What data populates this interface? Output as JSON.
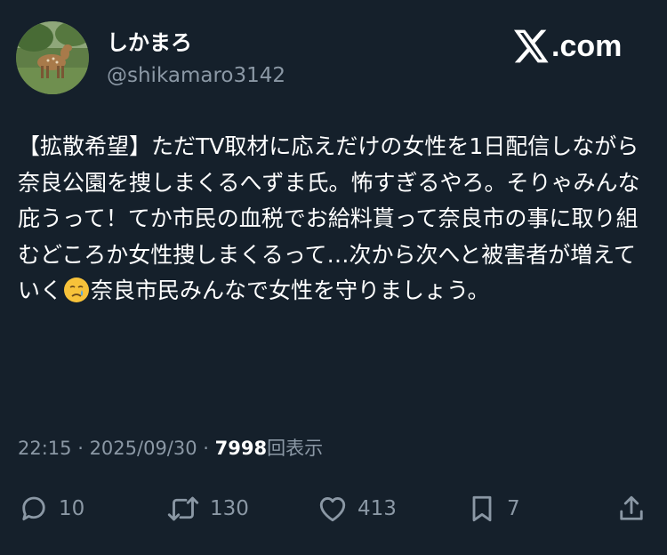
{
  "author": {
    "display_name": "しかまろ",
    "handle": "@shikamaro3142",
    "avatar_icon": "deer-photo-avatar"
  },
  "brand": {
    "icon": "x-logo-icon",
    "text": ".com"
  },
  "tweet": {
    "text_before_emoji": "【拡散希望】ただTV取材に応えだけの女性を1日配信しながら奈良公園を捜しまくるへずま氏。怖すぎるやろ。そりゃみんな庇うって！てか市民の血税でお給料貰って奈良市の事に取り組むどころか女性捜しまくるって…次から次へと被害者が増えていく",
    "emoji": "crying-face-emoji",
    "text_after_emoji": "奈良市民みんなで女性を守りましょう。"
  },
  "meta": {
    "time": "22:15",
    "separator1": " · ",
    "date": "2025/09/30",
    "separator2": " · ",
    "views_count": "7998",
    "views_label": "回表示"
  },
  "actions": {
    "replies": "10",
    "retweets": "130",
    "likes": "413",
    "bookmarks": "7"
  },
  "colors": {
    "background": "#15202b",
    "primary_text": "#ffffff",
    "secondary_text": "#8b98a5"
  }
}
